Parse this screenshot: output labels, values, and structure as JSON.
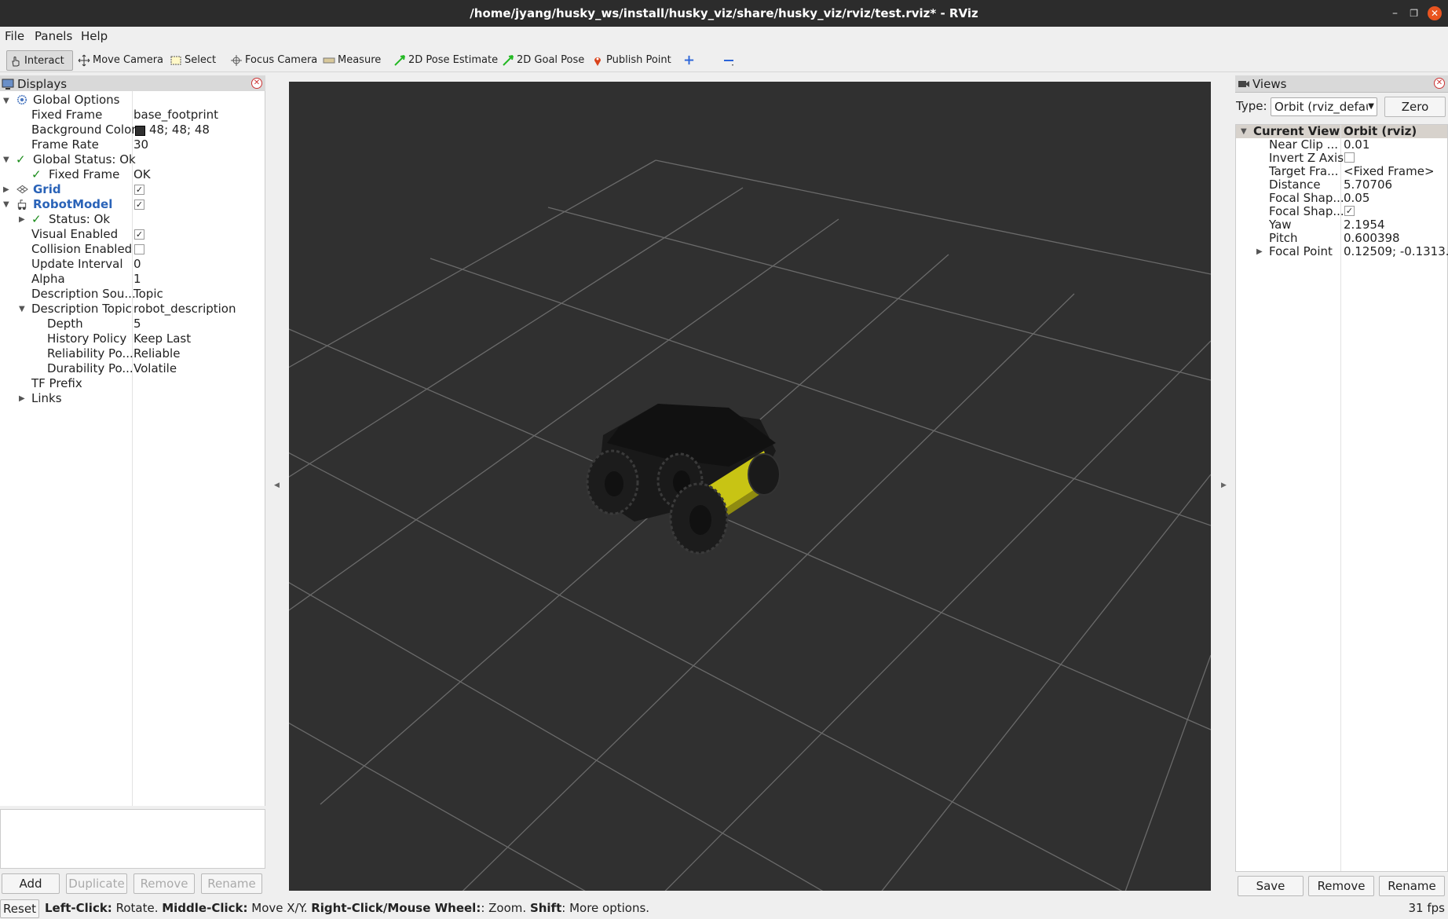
{
  "window": {
    "title": "/home/jyang/husky_ws/install/husky_viz/share/husky_viz/rviz/test.rviz* - RViz"
  },
  "menu": {
    "file": "File",
    "panels": "Panels",
    "help": "Help"
  },
  "toolbar": {
    "interact": "Interact",
    "move_camera": "Move Camera",
    "select": "Select",
    "focus_camera": "Focus Camera",
    "measure": "Measure",
    "pose_estimate": "2D Pose Estimate",
    "goal_pose": "2D Goal Pose",
    "publish_point": "Publish Point"
  },
  "displays": {
    "title": "Displays",
    "rows": {
      "global_options": "Global Options",
      "fixed_frame": "Fixed Frame",
      "fixed_frame_val": "base_footprint",
      "background_color": "Background Color",
      "background_color_val": "48; 48; 48",
      "frame_rate": "Frame Rate",
      "frame_rate_val": "30",
      "global_status": "Global Status: Ok",
      "status_fixed_frame": "Fixed Frame",
      "status_fixed_frame_val": "OK",
      "grid": "Grid",
      "robot_model": "RobotModel",
      "status_ok": "Status: Ok",
      "visual_enabled": "Visual Enabled",
      "collision_enabled": "Collision Enabled",
      "update_interval": "Update Interval",
      "update_interval_val": "0",
      "alpha": "Alpha",
      "alpha_val": "1",
      "description_source": "Description Sou...",
      "description_source_val": "Topic",
      "description_topic": "Description Topic",
      "description_topic_val": "robot_description",
      "depth": "Depth",
      "depth_val": "5",
      "history_policy": "History Policy",
      "history_policy_val": "Keep Last",
      "reliability": "Reliability Po...",
      "reliability_val": "Reliable",
      "durability": "Durability Po...",
      "durability_val": "Volatile",
      "tf_prefix": "TF Prefix",
      "links": "Links"
    },
    "buttons": {
      "add": "Add",
      "duplicate": "Duplicate",
      "remove": "Remove",
      "rename": "Rename"
    }
  },
  "views": {
    "title": "Views",
    "type_label": "Type:",
    "type_value": "Orbit (rviz_defau",
    "zero": "Zero",
    "current_view": "Current View",
    "current_view_val": "Orbit (rviz)",
    "props": [
      {
        "k": "Near Clip ...",
        "v": "0.01"
      },
      {
        "k": "Invert Z Axis",
        "v": ""
      },
      {
        "k": "Target Fra...",
        "v": "<Fixed Frame>"
      },
      {
        "k": "Distance",
        "v": "5.70706"
      },
      {
        "k": "Focal Shap...",
        "v": "0.05"
      },
      {
        "k": "Focal Shap...",
        "v": ""
      },
      {
        "k": "Yaw",
        "v": "2.1954"
      },
      {
        "k": "Pitch",
        "v": "0.600398"
      },
      {
        "k": "Focal Point",
        "v": "0.12509; -0.1313..."
      }
    ],
    "buttons": {
      "save": "Save",
      "remove": "Remove",
      "rename": "Rename"
    }
  },
  "status": {
    "reset": "Reset",
    "left_click": "Left-Click:",
    "left_click_desc": " Rotate. ",
    "middle_click": "Middle-Click:",
    "middle_click_desc": " Move X/Y. ",
    "right_click": "Right-Click/Mouse Wheel:",
    "right_click_desc": ": Zoom. ",
    "shift": "Shift",
    "shift_desc": ": More options.",
    "fps": "31 fps"
  }
}
